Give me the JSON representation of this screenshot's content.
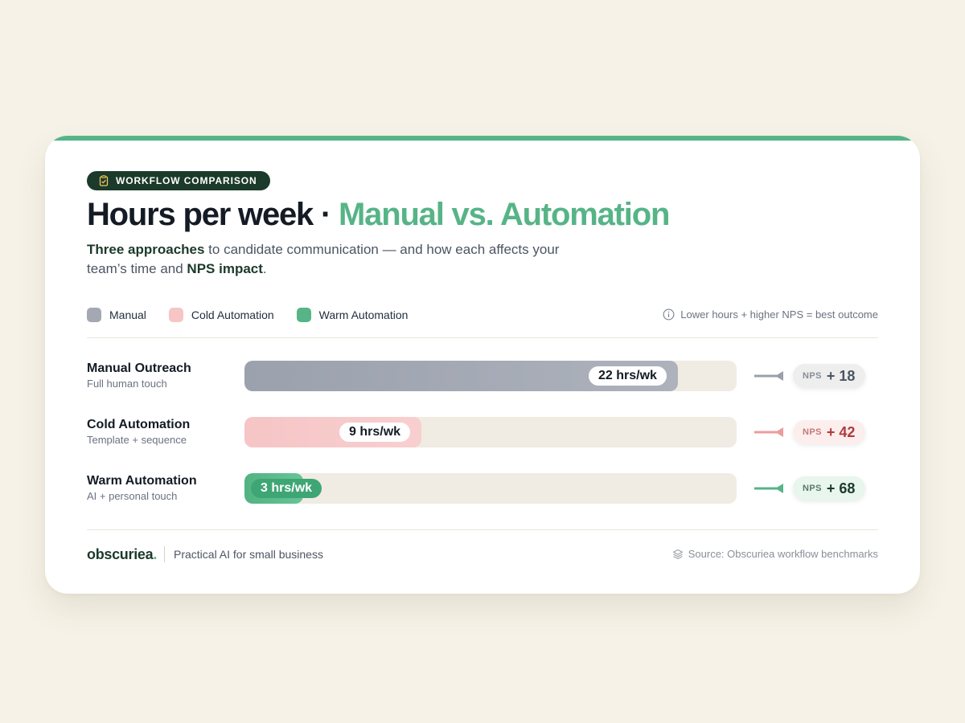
{
  "badge": {
    "icon": "clipboard-check-icon",
    "label": "WORKFLOW COMPARISON"
  },
  "title": {
    "main": "Hours per week · ",
    "accent": "Manual vs. Automation"
  },
  "subtitle": {
    "bold1": "Three approaches",
    "text1": " to candidate communication — and how each affects your team’s time and ",
    "bold2": "NPS impact",
    "text2": "."
  },
  "legend": [
    {
      "label": "Manual",
      "color": "#a3a8b3"
    },
    {
      "label": "Cold Automation",
      "color": "#f6c5c5"
    },
    {
      "label": "Warm Automation",
      "color": "#56b487"
    }
  ],
  "hint": {
    "icon": "info-icon",
    "text": "Lower hours + higher NPS = best outcome"
  },
  "colors": {
    "accent": "#56b487",
    "dark_green": "#1c3a2a",
    "manual": "#a3a8b3",
    "cold": "#f6c5c5",
    "warm": "#56b487",
    "track": "#f0ebe3"
  },
  "chart_data": {
    "type": "bar",
    "orientation": "horizontal",
    "title": "Hours per week · Manual vs. Automation",
    "unit": "hrs/wk",
    "xlim": [
      0,
      25
    ],
    "categories": [
      "Manual Outreach",
      "Cold Automation",
      "Warm Automation"
    ],
    "subtitles": [
      "Full human touch",
      "Template + sequence",
      "AI + personal touch"
    ],
    "values": [
      22,
      9,
      3
    ],
    "value_labels": [
      "22 hrs/wk",
      "9 hrs/wk",
      "3 hrs/wk"
    ],
    "series_colors": [
      "#a3a8b3",
      "#f6c5c5",
      "#56b487"
    ],
    "nps": {
      "label": "NPS",
      "values": [
        "+ 18",
        "+ 42",
        "+ 68"
      ]
    }
  },
  "footer": {
    "brand": "obscuriea",
    "brand_dot": ".",
    "tagline": "Practical AI for small business",
    "source_icon": "layers-icon",
    "source": "Source: Obscuriea workflow benchmarks"
  }
}
